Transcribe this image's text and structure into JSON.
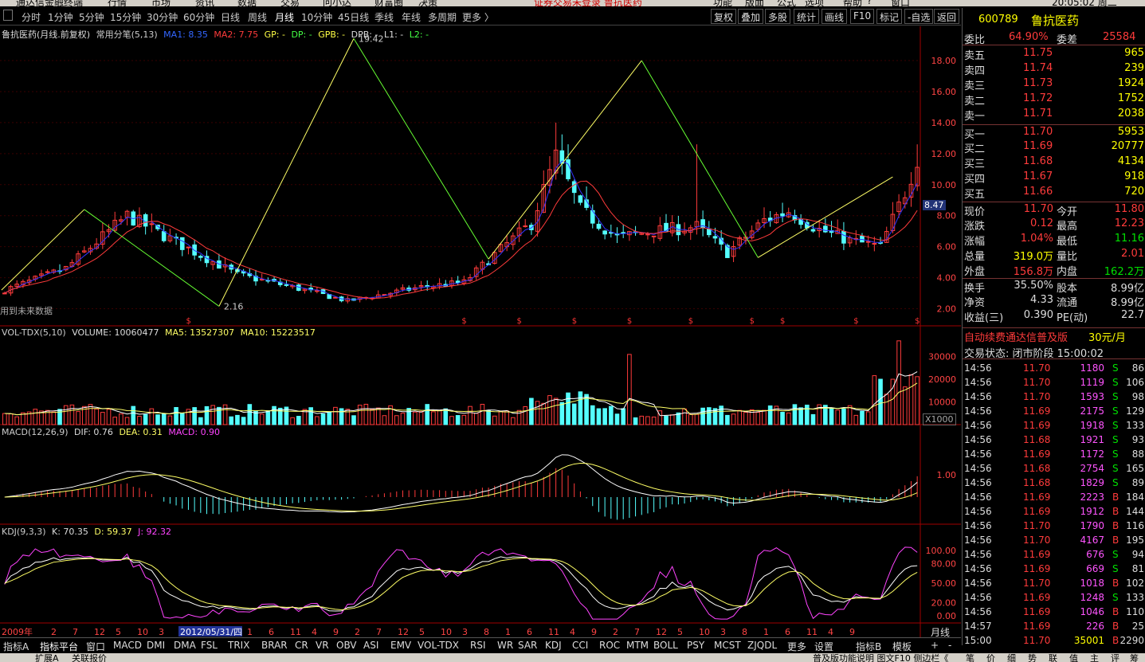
{
  "menubar": {
    "app_title": "通达信金融终端",
    "items": [
      "行情",
      "市场",
      "资讯",
      "数据",
      "交易",
      "问小达",
      "财富圈",
      "决策"
    ],
    "notice": "证券交易未登录 鲁抗医药",
    "right_items": [
      "功能",
      "版面",
      "公式",
      "选项",
      "帮助",
      "?",
      "窗口"
    ],
    "time": "20:05:02 周二"
  },
  "periods": [
    "分时",
    "1分钟",
    "5分钟",
    "15分钟",
    "30分钟",
    "60分钟",
    "日线",
    "周线",
    "月线",
    "10分钟",
    "45日线",
    "季线",
    "年线",
    "多周期",
    "更多 〉"
  ],
  "selected_period": "月线",
  "toolbar": [
    "复权",
    "叠加",
    "多股",
    "统计",
    "画线",
    "F10",
    "标记",
    "-自选",
    "返回"
  ],
  "main_header": {
    "stock": "鲁抗医药(月线.前复权)",
    "indicator": "常用分笔(5,13)",
    "ma1": "MA1: 8.35",
    "ma2": "MA2: 7.75",
    "gp": "GP: -",
    "dp": "DP: -",
    "gpb": "GPB: -",
    "dpb": "DPB: -",
    "l1": "L1: -",
    "l2": "L2: -"
  },
  "price_axis": [
    "18.00",
    "16.00",
    "14.00",
    "12.00",
    "10.00",
    "8.00",
    "6.00",
    "4.00",
    "2.00"
  ],
  "price_marker": "8.47",
  "annotations": {
    "peak": "19.42",
    "trough": "2.16",
    "note": "用到未来数据"
  },
  "vol_header": {
    "name": "VOL-TDX(5,10)",
    "volume": "VOLUME: 10060477",
    "ma5": "MA5: 13527307",
    "ma10": "MA10: 15223517"
  },
  "vol_axis": [
    "30000",
    "20000",
    "10000"
  ],
  "vol_unit": "X1000",
  "macd_header": {
    "name": "MACD(12,26,9)",
    "dif": "DIF: 0.76",
    "dea": "DEA: 0.31",
    "macd": "MACD: 0.90"
  },
  "macd_axis": [
    "1.00"
  ],
  "kdj_header": {
    "name": "KDJ(9,3,3)",
    "k": "K: 70.35",
    "d": "D: 59.37",
    "j": "J: 92.32"
  },
  "kdj_axis": [
    "100.00",
    "80.00",
    "50.00",
    "20.00",
    "0.00"
  ],
  "date_axis": [
    "2009年",
    "2",
    "7",
    "12",
    "5",
    "10",
    "3",
    "2012/05/31/四",
    "1",
    "6",
    "11",
    "4",
    "9",
    "2",
    "7",
    "12",
    "5",
    "10",
    "3",
    "8",
    "1",
    "6",
    "11",
    "4",
    "9",
    "2",
    "7",
    "12",
    "5",
    "10",
    "3",
    "8",
    "1",
    "6",
    "11",
    "4",
    "9"
  ],
  "period_label": "月线",
  "bottom_tabs": [
    "指标A",
    "指标平台",
    "窗口",
    "MACD",
    "DMI",
    "DMA",
    "FSL",
    "TRIX",
    "BRAR",
    "CR",
    "VR",
    "OBV",
    "ASI",
    "EMV",
    "VOL-TDX",
    "RSI",
    "WR",
    "SAR",
    "KDJ",
    "CCI",
    "ROC",
    "MTM",
    "BOLL",
    "PSY",
    "MCST",
    "ZJQDL",
    "更多",
    "设置"
  ],
  "bottom_right": [
    "指标B",
    "模板",
    "+",
    "-"
  ],
  "status": {
    "left1": "扩展A",
    "left2": "关联报价",
    "right": "普及版功能说明  图文F10  侧边栏《",
    "tabs": [
      "笔",
      "价",
      "细",
      "势",
      "联",
      "值",
      "主",
      "评",
      "筹"
    ]
  },
  "quote": {
    "code": "600789",
    "name": "鲁抗医药",
    "ratio_label": "委比",
    "ratio": "64.90%",
    "diff_label": "委差",
    "diff": "25584",
    "asks": [
      {
        "label": "卖五",
        "price": "11.75",
        "vol": "965"
      },
      {
        "label": "卖四",
        "price": "11.74",
        "vol": "239"
      },
      {
        "label": "卖三",
        "price": "11.73",
        "vol": "1924"
      },
      {
        "label": "卖二",
        "price": "11.72",
        "vol": "1752"
      },
      {
        "label": "卖一",
        "price": "11.71",
        "vol": "2038"
      }
    ],
    "bids": [
      {
        "label": "买一",
        "price": "11.70",
        "vol": "5953"
      },
      {
        "label": "买二",
        "price": "11.69",
        "vol": "20777"
      },
      {
        "label": "买三",
        "price": "11.68",
        "vol": "4134"
      },
      {
        "label": "买四",
        "price": "11.67",
        "vol": "918"
      },
      {
        "label": "买五",
        "price": "11.66",
        "vol": "720"
      }
    ],
    "stats": [
      {
        "l1": "现价",
        "v1": "11.70",
        "c1": "#ff3b3b",
        "l2": "今开",
        "v2": "11.80",
        "c2": "#ff3b3b"
      },
      {
        "l1": "涨跌",
        "v1": "0.12",
        "c1": "#ff3b3b",
        "l2": "最高",
        "v2": "12.23",
        "c2": "#ff3b3b"
      },
      {
        "l1": "涨幅",
        "v1": "1.04%",
        "c1": "#ff3b3b",
        "l2": "最低",
        "v2": "11.16",
        "c2": "#00e000"
      },
      {
        "l1": "总量",
        "v1": "319.0万",
        "c1": "#ffff00",
        "l2": "量比",
        "v2": "2.01",
        "c2": "#ff3b3b"
      },
      {
        "l1": "外盘",
        "v1": "156.8万",
        "c1": "#ff3b3b",
        "l2": "内盘",
        "v2": "162.2万",
        "c2": "#00e000"
      }
    ],
    "stats2": [
      {
        "l1": "换手",
        "v1": "35.50%",
        "l2": "股本",
        "v2": "8.99亿"
      },
      {
        "l1": "净资",
        "v1": "4.33",
        "l2": "流通",
        "v2": "8.99亿"
      },
      {
        "l1": "收益(三)",
        "v1": "0.390",
        "l2": "PE(动)",
        "v2": "22.7"
      }
    ],
    "promo": "自动续费通达信普及版",
    "promo_price": "30元/月",
    "trade_state": "交易状态: 闭市阶段 15:00:02",
    "ticks": [
      {
        "t": "14:56",
        "p": "11.70",
        "v": "1180",
        "s": "S",
        "n": "86"
      },
      {
        "t": "14:56",
        "p": "11.70",
        "v": "1119",
        "s": "S",
        "n": "106"
      },
      {
        "t": "14:56",
        "p": "11.70",
        "v": "1593",
        "s": "S",
        "n": "98"
      },
      {
        "t": "14:56",
        "p": "11.69",
        "v": "2175",
        "s": "S",
        "n": "129"
      },
      {
        "t": "14:56",
        "p": "11.69",
        "v": "1918",
        "s": "S",
        "n": "133"
      },
      {
        "t": "14:56",
        "p": "11.68",
        "v": "1921",
        "s": "S",
        "n": "93"
      },
      {
        "t": "14:56",
        "p": "11.69",
        "v": "1172",
        "s": "S",
        "n": "88"
      },
      {
        "t": "14:56",
        "p": "11.68",
        "v": "2754",
        "s": "S",
        "n": "165"
      },
      {
        "t": "14:56",
        "p": "11.68",
        "v": "1829",
        "s": "S",
        "n": "89"
      },
      {
        "t": "14:56",
        "p": "11.69",
        "v": "2223",
        "s": "B",
        "n": "184"
      },
      {
        "t": "14:56",
        "p": "11.69",
        "v": "1912",
        "s": "B",
        "n": "144"
      },
      {
        "t": "14:56",
        "p": "11.70",
        "v": "1790",
        "s": "B",
        "n": "116"
      },
      {
        "t": "14:56",
        "p": "11.70",
        "v": "4167",
        "s": "B",
        "n": "195"
      },
      {
        "t": "14:56",
        "p": "11.69",
        "v": "676",
        "s": "S",
        "n": "94"
      },
      {
        "t": "14:56",
        "p": "11.69",
        "v": "669",
        "s": "S",
        "n": "81"
      },
      {
        "t": "14:56",
        "p": "11.70",
        "v": "1018",
        "s": "B",
        "n": "102"
      },
      {
        "t": "14:56",
        "p": "11.69",
        "v": "1248",
        "s": "S",
        "n": "133"
      },
      {
        "t": "14:56",
        "p": "11.69",
        "v": "1046",
        "s": "B",
        "n": "110"
      },
      {
        "t": "14:57",
        "p": "11.69",
        "v": "226",
        "s": "B",
        "n": "25"
      },
      {
        "t": "15:00",
        "p": "11.70",
        "v": "35001",
        "s": "B",
        "n": "2290"
      }
    ]
  },
  "colors": {
    "up": "#ff3b3b",
    "down": "#54ffff",
    "ma1": "#3333ff",
    "ma2": "#ff3b3b",
    "zigzag_up": "#ffff66",
    "zigzag_down": "#66ff33",
    "grid": "#3a0000"
  }
}
